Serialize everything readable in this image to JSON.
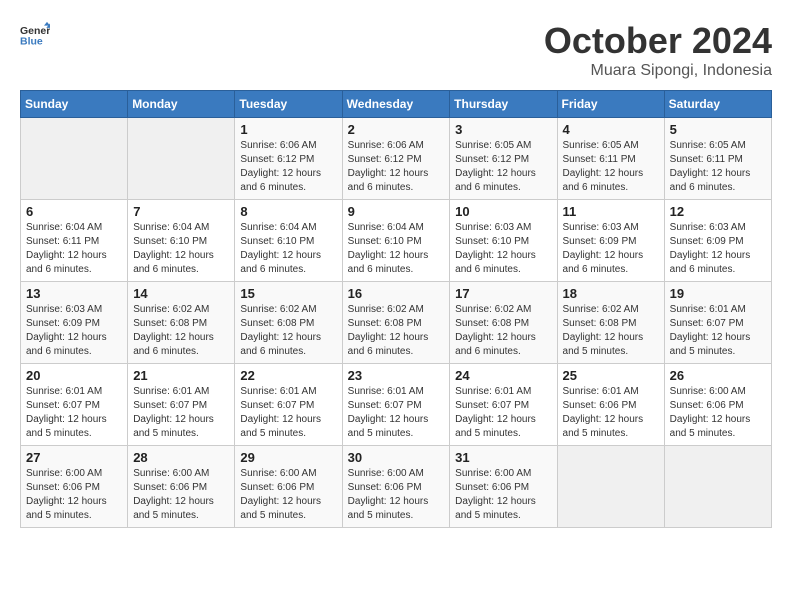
{
  "header": {
    "logo_line1": "General",
    "logo_line2": "Blue",
    "month_title": "October 2024",
    "location": "Muara Sipongi, Indonesia"
  },
  "calendar": {
    "days_of_week": [
      "Sunday",
      "Monday",
      "Tuesday",
      "Wednesday",
      "Thursday",
      "Friday",
      "Saturday"
    ],
    "weeks": [
      [
        {
          "day": "",
          "info": ""
        },
        {
          "day": "",
          "info": ""
        },
        {
          "day": "1",
          "info": "Sunrise: 6:06 AM\nSunset: 6:12 PM\nDaylight: 12 hours\nand 6 minutes."
        },
        {
          "day": "2",
          "info": "Sunrise: 6:06 AM\nSunset: 6:12 PM\nDaylight: 12 hours\nand 6 minutes."
        },
        {
          "day": "3",
          "info": "Sunrise: 6:05 AM\nSunset: 6:12 PM\nDaylight: 12 hours\nand 6 minutes."
        },
        {
          "day": "4",
          "info": "Sunrise: 6:05 AM\nSunset: 6:11 PM\nDaylight: 12 hours\nand 6 minutes."
        },
        {
          "day": "5",
          "info": "Sunrise: 6:05 AM\nSunset: 6:11 PM\nDaylight: 12 hours\nand 6 minutes."
        }
      ],
      [
        {
          "day": "6",
          "info": "Sunrise: 6:04 AM\nSunset: 6:11 PM\nDaylight: 12 hours\nand 6 minutes."
        },
        {
          "day": "7",
          "info": "Sunrise: 6:04 AM\nSunset: 6:10 PM\nDaylight: 12 hours\nand 6 minutes."
        },
        {
          "day": "8",
          "info": "Sunrise: 6:04 AM\nSunset: 6:10 PM\nDaylight: 12 hours\nand 6 minutes."
        },
        {
          "day": "9",
          "info": "Sunrise: 6:04 AM\nSunset: 6:10 PM\nDaylight: 12 hours\nand 6 minutes."
        },
        {
          "day": "10",
          "info": "Sunrise: 6:03 AM\nSunset: 6:10 PM\nDaylight: 12 hours\nand 6 minutes."
        },
        {
          "day": "11",
          "info": "Sunrise: 6:03 AM\nSunset: 6:09 PM\nDaylight: 12 hours\nand 6 minutes."
        },
        {
          "day": "12",
          "info": "Sunrise: 6:03 AM\nSunset: 6:09 PM\nDaylight: 12 hours\nand 6 minutes."
        }
      ],
      [
        {
          "day": "13",
          "info": "Sunrise: 6:03 AM\nSunset: 6:09 PM\nDaylight: 12 hours\nand 6 minutes."
        },
        {
          "day": "14",
          "info": "Sunrise: 6:02 AM\nSunset: 6:08 PM\nDaylight: 12 hours\nand 6 minutes."
        },
        {
          "day": "15",
          "info": "Sunrise: 6:02 AM\nSunset: 6:08 PM\nDaylight: 12 hours\nand 6 minutes."
        },
        {
          "day": "16",
          "info": "Sunrise: 6:02 AM\nSunset: 6:08 PM\nDaylight: 12 hours\nand 6 minutes."
        },
        {
          "day": "17",
          "info": "Sunrise: 6:02 AM\nSunset: 6:08 PM\nDaylight: 12 hours\nand 6 minutes."
        },
        {
          "day": "18",
          "info": "Sunrise: 6:02 AM\nSunset: 6:08 PM\nDaylight: 12 hours\nand 5 minutes."
        },
        {
          "day": "19",
          "info": "Sunrise: 6:01 AM\nSunset: 6:07 PM\nDaylight: 12 hours\nand 5 minutes."
        }
      ],
      [
        {
          "day": "20",
          "info": "Sunrise: 6:01 AM\nSunset: 6:07 PM\nDaylight: 12 hours\nand 5 minutes."
        },
        {
          "day": "21",
          "info": "Sunrise: 6:01 AM\nSunset: 6:07 PM\nDaylight: 12 hours\nand 5 minutes."
        },
        {
          "day": "22",
          "info": "Sunrise: 6:01 AM\nSunset: 6:07 PM\nDaylight: 12 hours\nand 5 minutes."
        },
        {
          "day": "23",
          "info": "Sunrise: 6:01 AM\nSunset: 6:07 PM\nDaylight: 12 hours\nand 5 minutes."
        },
        {
          "day": "24",
          "info": "Sunrise: 6:01 AM\nSunset: 6:07 PM\nDaylight: 12 hours\nand 5 minutes."
        },
        {
          "day": "25",
          "info": "Sunrise: 6:01 AM\nSunset: 6:06 PM\nDaylight: 12 hours\nand 5 minutes."
        },
        {
          "day": "26",
          "info": "Sunrise: 6:00 AM\nSunset: 6:06 PM\nDaylight: 12 hours\nand 5 minutes."
        }
      ],
      [
        {
          "day": "27",
          "info": "Sunrise: 6:00 AM\nSunset: 6:06 PM\nDaylight: 12 hours\nand 5 minutes."
        },
        {
          "day": "28",
          "info": "Sunrise: 6:00 AM\nSunset: 6:06 PM\nDaylight: 12 hours\nand 5 minutes."
        },
        {
          "day": "29",
          "info": "Sunrise: 6:00 AM\nSunset: 6:06 PM\nDaylight: 12 hours\nand 5 minutes."
        },
        {
          "day": "30",
          "info": "Sunrise: 6:00 AM\nSunset: 6:06 PM\nDaylight: 12 hours\nand 5 minutes."
        },
        {
          "day": "31",
          "info": "Sunrise: 6:00 AM\nSunset: 6:06 PM\nDaylight: 12 hours\nand 5 minutes."
        },
        {
          "day": "",
          "info": ""
        },
        {
          "day": "",
          "info": ""
        }
      ]
    ]
  }
}
